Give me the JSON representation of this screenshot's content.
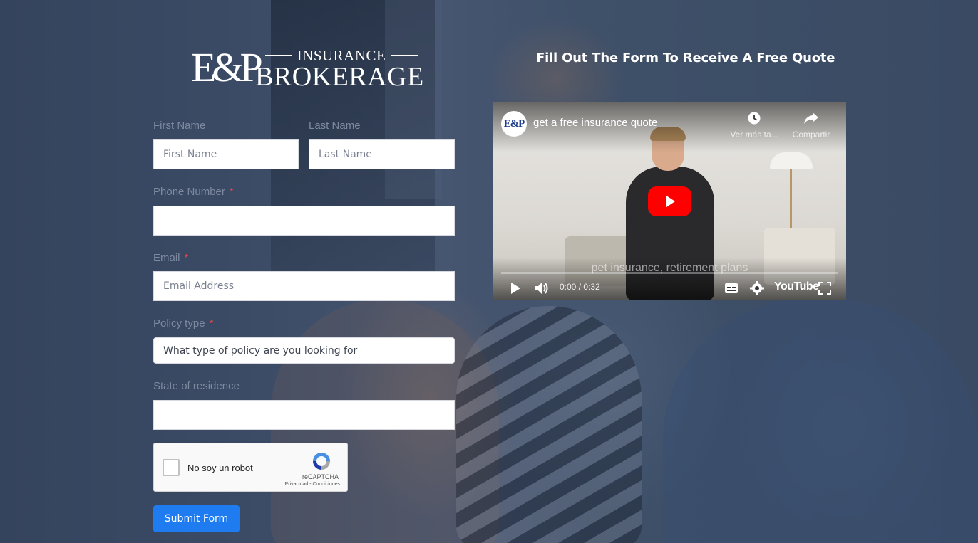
{
  "brand": {
    "logo_mark": "E&P",
    "logo_top": "INSURANCE",
    "logo_bottom": "BROKERAGE"
  },
  "heading": "Fill Out The Form To Receive A Free Quote",
  "form": {
    "first_name": {
      "label": "First Name",
      "placeholder": "First Name",
      "value": ""
    },
    "last_name": {
      "label": "Last Name",
      "placeholder": "Last Name",
      "value": ""
    },
    "phone": {
      "label": "Phone Number",
      "required": "*",
      "value": ""
    },
    "email": {
      "label": "Email",
      "required": "*",
      "placeholder": "Email Address",
      "value": ""
    },
    "policy_type": {
      "label": "Policy type",
      "required": "*",
      "selected": "What type of policy are you looking for"
    },
    "state": {
      "label": "State of residence",
      "value": ""
    },
    "captcha": {
      "label": "No soy un robot",
      "brand": "reCAPTCHA",
      "links": "Privacidad - Condiciones"
    },
    "submit_label": "Submit Form"
  },
  "video": {
    "channel_avatar": "E&P",
    "title": "get a free insurance quote",
    "watch_later": "Ver más ta...",
    "share": "Compartir",
    "caption": "pet insurance, retirement plans",
    "time": "0:00 / 0:32",
    "platform": "YouTube",
    "progress": 0
  },
  "colors": {
    "accent": "#1f7cf0",
    "required": "#e0474c",
    "youtube_red": "#ff0000"
  },
  "icons": [
    "clock-icon",
    "share-icon",
    "play-icon",
    "volume-icon",
    "captions-icon",
    "settings-icon",
    "fullscreen-icon",
    "recaptcha-icon"
  ]
}
